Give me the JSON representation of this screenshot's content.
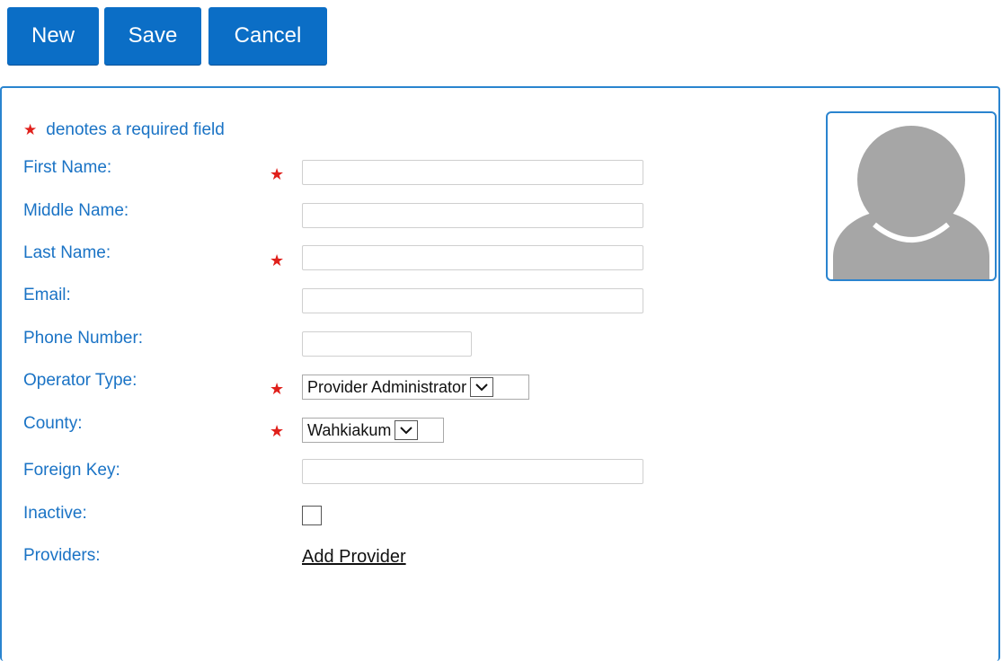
{
  "toolbar": {
    "new_label": "New",
    "save_label": "Save",
    "cancel_label": "Cancel"
  },
  "form": {
    "legend_text": "denotes a required field",
    "required_symbol": "★",
    "fields": {
      "first_name": {
        "label": "First Name:",
        "value": ""
      },
      "middle_name": {
        "label": "Middle Name:",
        "value": ""
      },
      "last_name": {
        "label": "Last Name:",
        "value": ""
      },
      "email": {
        "label": "Email:",
        "value": ""
      },
      "phone_number": {
        "label": "Phone Number:",
        "value": ""
      },
      "operator_type": {
        "label": "Operator Type:",
        "value": "Provider Administrator"
      },
      "county": {
        "label": "County:",
        "value": "Wahkiakum"
      },
      "foreign_key": {
        "label": "Foreign Key:",
        "value": ""
      },
      "inactive": {
        "label": "Inactive:",
        "checked": false
      },
      "providers": {
        "label": "Providers:",
        "link_text": "Add Provider"
      }
    }
  },
  "avatar": {
    "icon": "user-placeholder-icon"
  },
  "colors": {
    "button_bg": "#0b6ec6",
    "label_blue": "#1a73c5",
    "required_red": "#e0201b",
    "panel_border": "#2a84cf",
    "avatar_gray": "#a6a6a6"
  }
}
